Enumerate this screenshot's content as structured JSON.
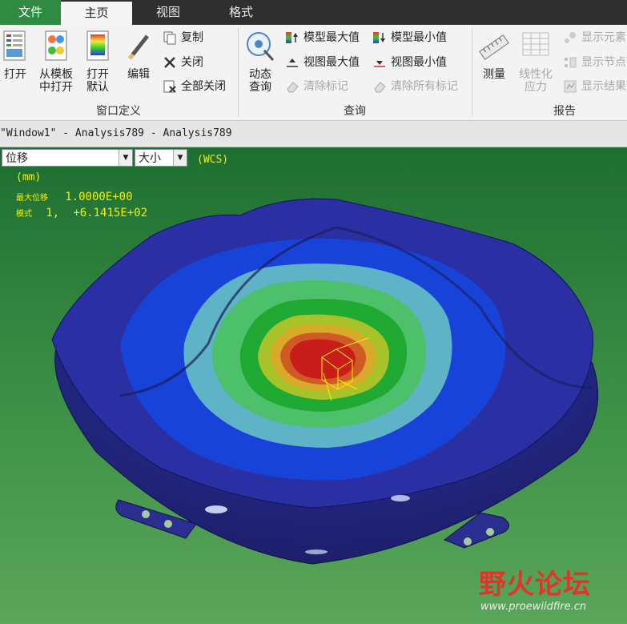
{
  "tabs": {
    "file": "文件",
    "home": "主页",
    "view": "视图",
    "format": "格式"
  },
  "ribbon": {
    "window_def": {
      "open": "打开",
      "from_template_1": "从模板",
      "from_template_2": "中打开",
      "open_default_1": "打开",
      "open_default_2": "默认",
      "edit": "编辑",
      "copy": "复制",
      "close": "关闭",
      "close_all": "全部关闭",
      "group_label": "窗口定义"
    },
    "query": {
      "dynamic_query_1": "动态",
      "dynamic_query_2": "查询",
      "model_max": "模型最大值",
      "model_min": "模型最小值",
      "view_max": "视图最大值",
      "view_min": "视图最小值",
      "clear_marks": "清除标记",
      "clear_all_marks": "清除所有标记",
      "group_label": "查询"
    },
    "report": {
      "measure": "测量",
      "linearize_1": "线性化",
      "linearize_2": "应力",
      "show_elements": "显示元素",
      "show_nodes": "显示节点",
      "show_results": "显示结果",
      "group_label": "报告"
    }
  },
  "window_title": "\"Window1\" - Analysis789 - Analysis789",
  "viewport": {
    "quantity_select": "位移",
    "component_select": "大小",
    "coord_system": "(WCS)",
    "unit": "(mm)",
    "max_disp_label": "最大位移",
    "max_disp_value": "1.0000E+00",
    "mode_label": "模式",
    "mode_index": "1,",
    "mode_value": "+6.1415E+02"
  },
  "watermark": {
    "text": "野火论坛",
    "url": "www.proewildfire.cn"
  },
  "colors": {
    "tab_file_bg": "#2e8b3f",
    "tabbar_bg": "#2f2f2f",
    "viewport_bg": "#3d9147",
    "overlay_text": "#f1f104",
    "watermark_red": "#e0352b"
  }
}
